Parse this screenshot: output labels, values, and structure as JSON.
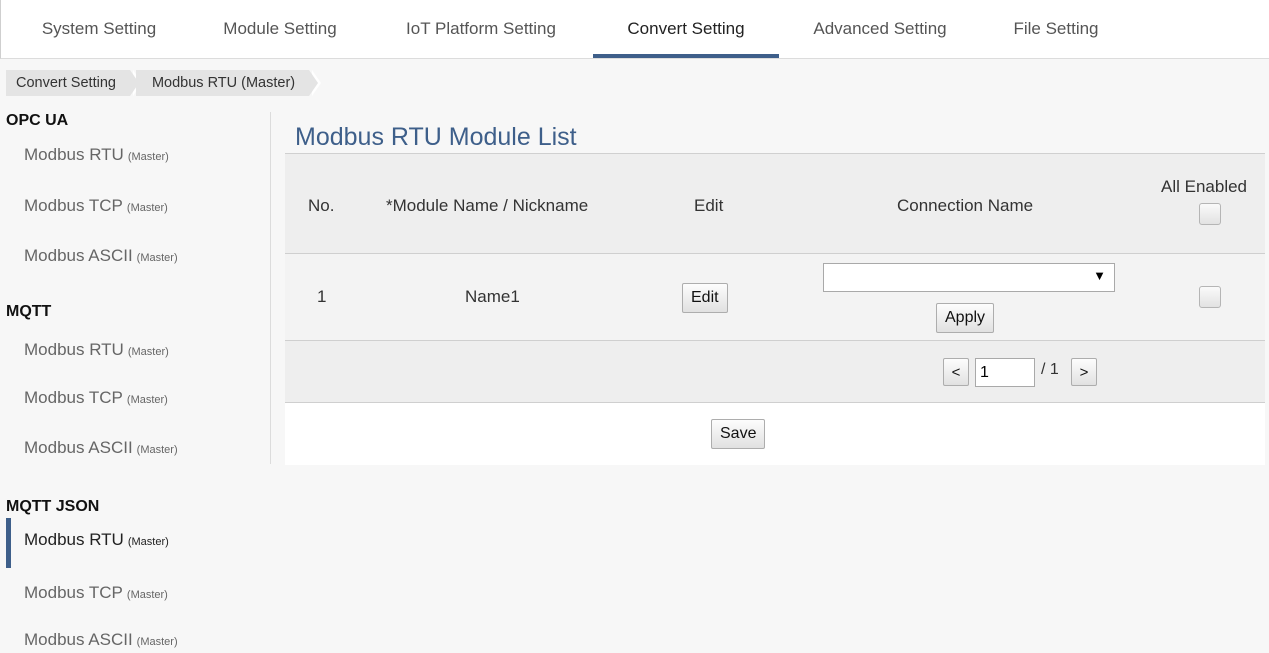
{
  "topnav": {
    "tabs": [
      {
        "label": "System Setting"
      },
      {
        "label": "Module Setting"
      },
      {
        "label": "IoT Platform Setting"
      },
      {
        "label": "Convert Setting"
      },
      {
        "label": "Advanced Setting"
      },
      {
        "label": "File Setting"
      }
    ],
    "active_index": 3
  },
  "breadcrumb": [
    "Convert Setting",
    "Modbus RTU (Master)"
  ],
  "sidebar": {
    "groups": [
      {
        "title": "OPC UA",
        "items": [
          {
            "name": "Modbus RTU",
            "tag": "(Master)"
          },
          {
            "name": "Modbus TCP",
            "tag": "(Master)"
          },
          {
            "name": "Modbus ASCII",
            "tag": "(Master)"
          }
        ]
      },
      {
        "title": "MQTT",
        "items": [
          {
            "name": "Modbus RTU",
            "tag": "(Master)"
          },
          {
            "name": "Modbus TCP",
            "tag": "(Master)"
          },
          {
            "name": "Modbus ASCII",
            "tag": "(Master)"
          }
        ]
      },
      {
        "title": "MQTT JSON",
        "items": [
          {
            "name": "Modbus RTU",
            "tag": "(Master)"
          },
          {
            "name": "Modbus TCP",
            "tag": "(Master)"
          },
          {
            "name": "Modbus ASCII",
            "tag": "(Master)"
          }
        ]
      }
    ],
    "active": "MQTT JSON / Modbus RTU"
  },
  "main": {
    "title": "Modbus RTU Module List",
    "columns": {
      "no": "No.",
      "module_name": "*Module Name / Nickname",
      "edit": "Edit",
      "connection_name": "Connection Name",
      "all_enabled": "All Enabled"
    },
    "rows": [
      {
        "no": "1",
        "name": "Name1",
        "edit_label": "Edit",
        "connection_value": "",
        "apply_label": "Apply",
        "enabled": false
      }
    ],
    "pager": {
      "prev": "<",
      "current": "1",
      "total": "/ 1",
      "next": ">"
    },
    "save_label": "Save"
  },
  "colors": {
    "accent": "#3e5f8a"
  }
}
